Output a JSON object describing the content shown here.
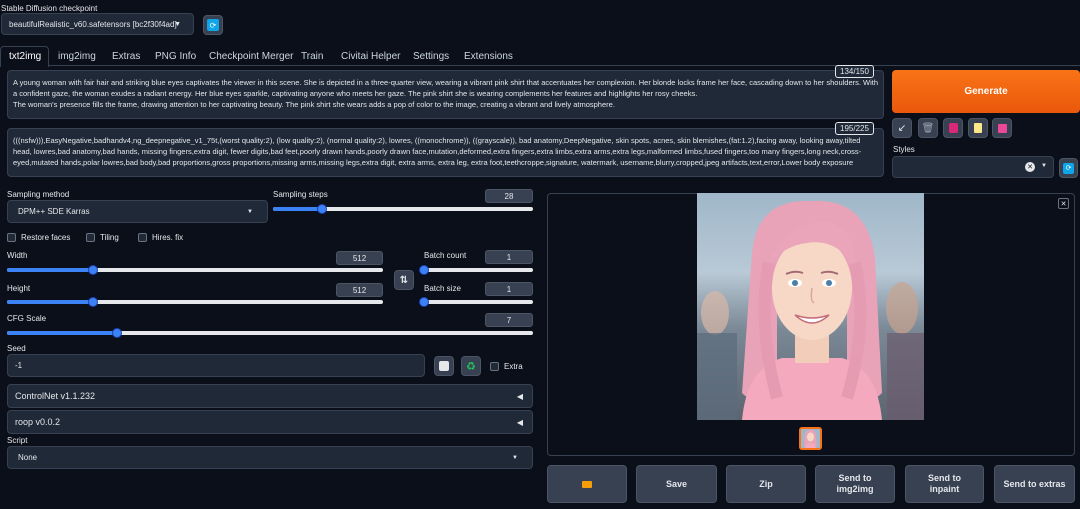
{
  "checkpoint": {
    "label": "Stable Diffusion checkpoint",
    "value": "beautifulRealistic_v60.safetensors [bc2f30f4ad]",
    "refresh_icon": "refresh-icon"
  },
  "tabs": [
    "txt2img",
    "img2img",
    "Extras",
    "PNG Info",
    "Checkpoint Merger",
    "Train",
    "Civitai Helper",
    "Settings",
    "Extensions"
  ],
  "active_tab": "txt2img",
  "prompt": {
    "text": "A young woman with fair hair and striking blue eyes captivates the viewer in this scene. She is depicted in a three-quarter view, wearing a vibrant pink shirt that accentuates her complexion. Her blonde locks frame her face, cascading down to her shoulders. With a confident gaze, the woman exudes a radiant energy. Her blue eyes sparkle, captivating anyone who meets her gaze. The pink shirt she is wearing complements her features and highlights her rosy cheeks.\nThe woman's presence fills the frame, drawing attention to her captivating beauty. The pink shirt she wears adds a pop of color to the image, creating a vibrant and lively atmosphere.",
    "counter": "134/150"
  },
  "negative_prompt": {
    "text": "(((nsfw))),EasyNegative,badhandv4,ng_deepnegative_v1_75t,(worst quality:2), (low quality:2), (normal quality:2), lowres, ((monochrome)), ((grayscale)), bad anatomy,DeepNegative, skin spots, acnes, skin blemishes,(fat:1.2),facing away, looking away,tilted head, lowres,bad anatomy,bad hands, missing fingers,extra digit, fewer digits,bad feet,poorly drawn hands,poorly drawn face,mutation,deformed,extra fingers,extra limbs,extra arms,extra legs,malformed limbs,fused fingers,too many fingers,long neck,cross-eyed,mutated hands,polar lowres,bad body,bad proportions,gross proportions,missing arms,missing legs,extra digit, extra arms, extra leg, extra foot,teethcroppe,signature, watermark, username,blurry,cropped,jpeg artifacts,text,error,Lower body exposure",
    "counter": "195/225"
  },
  "generate_label": "Generate",
  "styles_label": "Styles",
  "sampling": {
    "method_label": "Sampling method",
    "method_value": "DPM++ SDE Karras",
    "steps_label": "Sampling steps",
    "steps_value": "28",
    "steps_fraction": 0.19
  },
  "checkboxes": {
    "restore_faces": "Restore faces",
    "tiling": "Tiling",
    "hires_fix": "Hires. fix"
  },
  "width": {
    "label": "Width",
    "value": "512",
    "fraction": 0.23
  },
  "height": {
    "label": "Height",
    "value": "512",
    "fraction": 0.23
  },
  "batch_count": {
    "label": "Batch count",
    "value": "1",
    "fraction": 0.0
  },
  "batch_size": {
    "label": "Batch size",
    "value": "1",
    "fraction": 0.0
  },
  "cfg_scale": {
    "label": "CFG Scale",
    "value": "7",
    "fraction": 0.21
  },
  "seed": {
    "label": "Seed",
    "value": "-1",
    "extra_label": "Extra"
  },
  "accordions": [
    "ControlNet v1.1.232",
    "roop v0.0.2"
  ],
  "script": {
    "label": "Script",
    "value": "None"
  },
  "output_buttons": [
    "Save",
    "Zip",
    "Send to img2img",
    "Send to inpaint",
    "Send to extras"
  ],
  "colors": {
    "background": "#0b0f19",
    "panel": "#1f2937",
    "accent_orange": "#f97316",
    "slider_blue": "#3b82f6"
  }
}
